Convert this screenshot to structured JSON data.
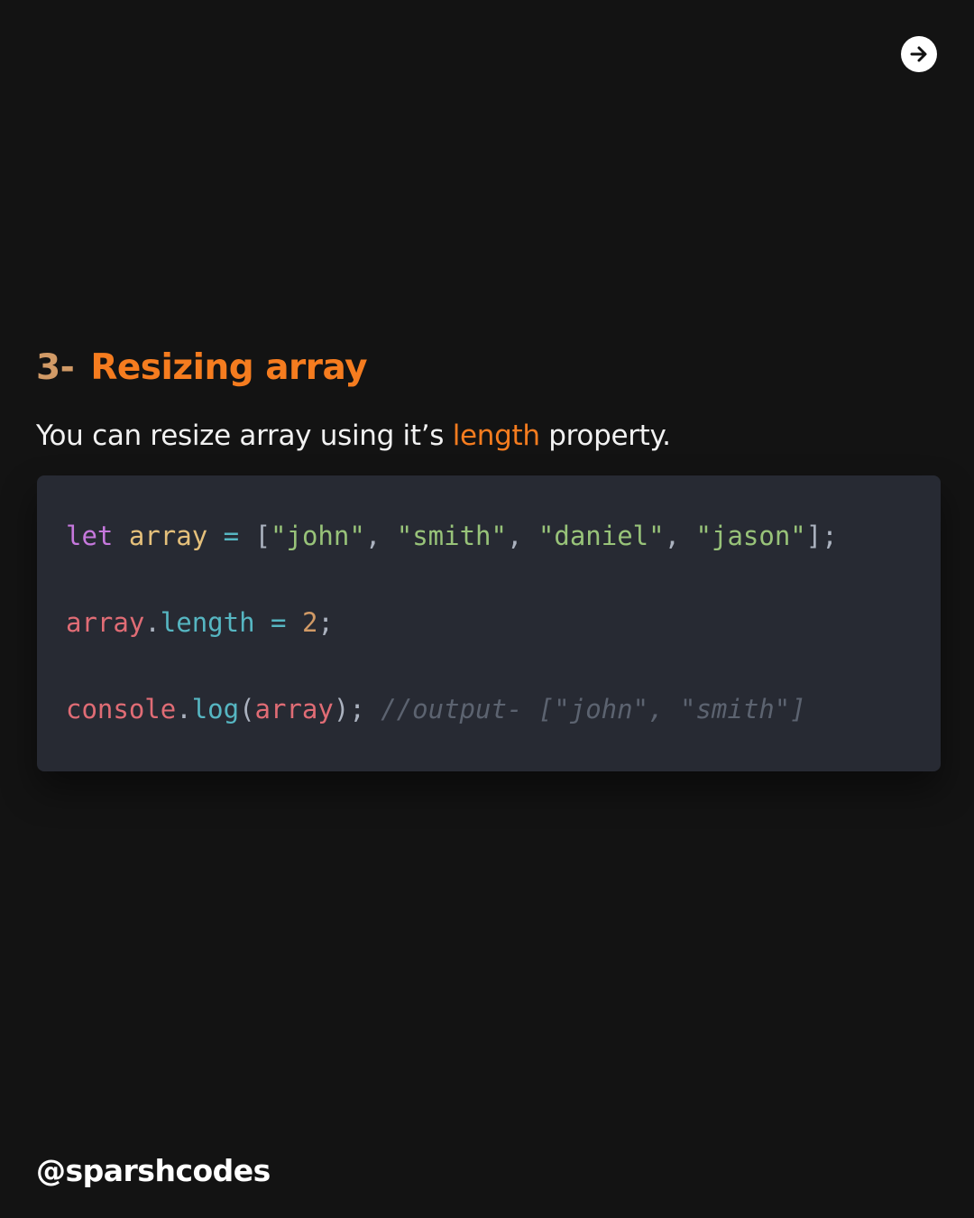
{
  "nav": {
    "next_icon": "arrow-right-icon"
  },
  "heading": {
    "number": "3-",
    "title": "Resizing array"
  },
  "description": {
    "before": "You can resize array using it’s ",
    "highlight": "length",
    "after": " property."
  },
  "code": {
    "line1": {
      "keyword": "let",
      "variable": "array",
      "operator": "=",
      "open": "[",
      "items": [
        "\"john\"",
        "\"smith\"",
        "\"daniel\"",
        "\"jason\""
      ],
      "separator": ",",
      "close": "];"
    },
    "line2": {
      "object": "array",
      "dot": ".",
      "property": "length",
      "operator": "=",
      "value": "2",
      "end": ";"
    },
    "line3": {
      "object": "console",
      "dot": ".",
      "method": "log",
      "open": "(",
      "argument": "array",
      "close": ");",
      "comment": "//output- [\"john\", \"smith\"]"
    }
  },
  "footer": {
    "handle": "@sparshcodes"
  },
  "colors": {
    "background": "#131313",
    "accent": "#f57c1f",
    "code_background": "#272a33",
    "text": "#f2f2f2"
  }
}
